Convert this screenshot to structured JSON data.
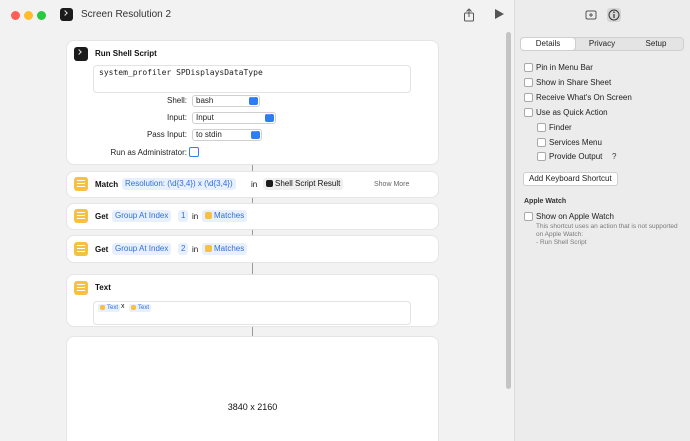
{
  "window": {
    "title": "Screen Resolution 2"
  },
  "shell_action": {
    "title": "Run Shell Script",
    "script": "system_profiler SPDisplaysDataType",
    "shell_label": "Shell:",
    "shell_value": "bash",
    "input_label": "Input:",
    "input_value": "Input",
    "pass_input_label": "Pass Input:",
    "pass_input_value": "to stdin",
    "run_admin_label": "Run as Administrator:"
  },
  "match_action": {
    "verb": "Match",
    "pattern": "Resolution: (\\d{3,4}) x (\\d{3,4})",
    "in_label": "in",
    "source": "Shell Script Result",
    "show_more": "Show More"
  },
  "get_actions": [
    {
      "verb": "Get",
      "group": "Group At Index",
      "index": "1",
      "in_label": "in",
      "source": "Matches"
    },
    {
      "verb": "Get",
      "group": "Group At Index",
      "index": "2",
      "in_label": "in",
      "source": "Matches"
    }
  ],
  "text_action": {
    "title": "Text",
    "token1": "Text",
    "separator": "x",
    "token2": "Text"
  },
  "result": {
    "value": "3840 x 2160"
  },
  "inspector": {
    "tabs": [
      "Details",
      "Privacy",
      "Setup"
    ],
    "active_tab": "Details",
    "options": [
      {
        "label": "Pin in Menu Bar",
        "checked": false
      },
      {
        "label": "Show in Share Sheet",
        "checked": false
      },
      {
        "label": "Receive What's On Screen",
        "checked": false
      },
      {
        "label": "Use as Quick Action",
        "checked": false
      }
    ],
    "quick_action_options": [
      {
        "label": "Finder",
        "checked": false
      },
      {
        "label": "Services Menu",
        "checked": false
      },
      {
        "label": "Provide Output",
        "checked": false
      }
    ],
    "help_mark": "?",
    "keyboard_shortcut_button": "Add Keyboard Shortcut",
    "apple_watch_title": "Apple Watch",
    "apple_watch_option": "Show on Apple Watch",
    "apple_watch_note": "This shortcut uses an action that is not supported on Apple Watch:",
    "apple_watch_note_item": "- Run Shell Script"
  },
  "colors": {
    "accent": "#2f7cf6",
    "text_action_icon": "#f5c142",
    "terminal_icon": "#1b1b1b"
  }
}
